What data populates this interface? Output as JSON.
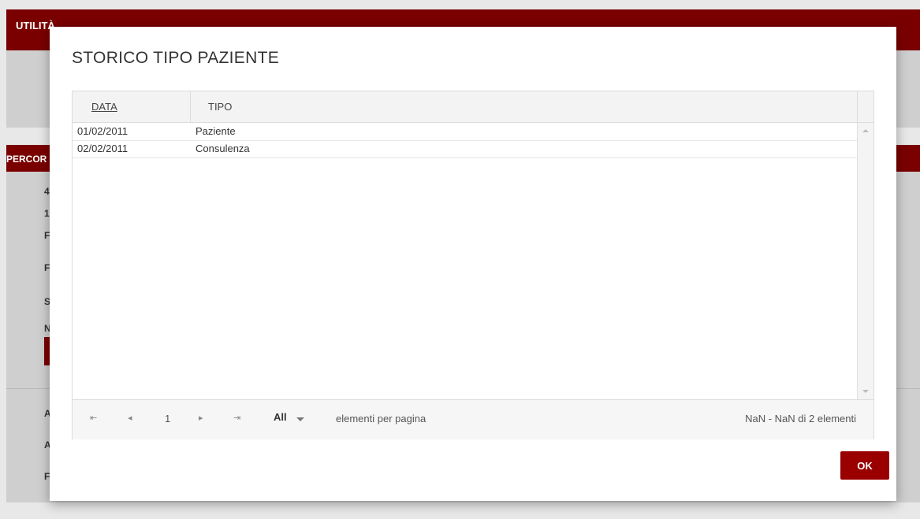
{
  "background": {
    "top_bar_title": "UTILITÀ",
    "section_title": "PERCOR",
    "sidebar_letters": [
      "4",
      "1",
      "F",
      "F",
      "S",
      "N",
      "A",
      "A",
      "F"
    ]
  },
  "modal": {
    "title": "STORICO TIPO PAZIENTE",
    "columns": {
      "date": "DATA",
      "type": "TIPO"
    },
    "rows": [
      {
        "date": "01/02/2011",
        "type": "Paziente"
      },
      {
        "date": "02/02/2011",
        "type": "Consulenza"
      }
    ],
    "pager": {
      "first_icon": "⇤",
      "prev_icon": "◂",
      "current_page": "1",
      "next_icon": "▸",
      "last_icon": "⇥",
      "page_size": "All",
      "page_size_label": "elementi per pagina",
      "info": "NaN - NaN di 2 elementi"
    },
    "ok_label": "OK"
  },
  "colors": {
    "brand_red": "#7a0000",
    "button_red": "#9b0000"
  }
}
